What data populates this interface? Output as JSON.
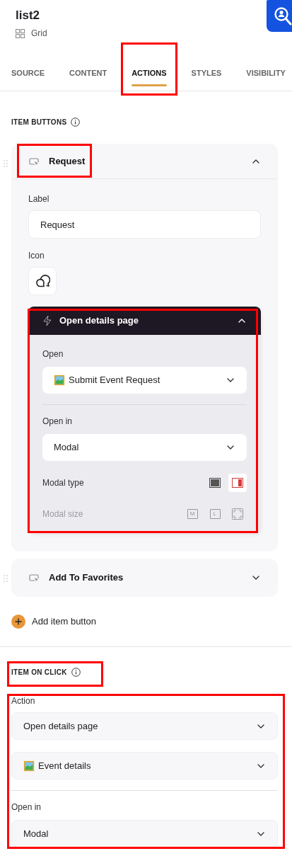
{
  "header": {
    "title": "list2",
    "subtitle": "Grid"
  },
  "tabs": [
    {
      "label": "SOURCE",
      "selected": false,
      "highlighted": false
    },
    {
      "label": "CONTENT",
      "selected": false,
      "highlighted": false
    },
    {
      "label": "ACTIONS",
      "selected": true,
      "highlighted": true
    },
    {
      "label": "STYLES",
      "selected": false,
      "highlighted": false
    },
    {
      "label": "VISIBILITY",
      "selected": false,
      "highlighted": false
    }
  ],
  "item_buttons": {
    "heading": "ITEM BUTTONS",
    "buttons": [
      {
        "label": "Request",
        "expanded": true,
        "highlighted": true,
        "label_field": {
          "label": "Label",
          "value": "Request"
        },
        "icon_field": {
          "label": "Icon"
        },
        "action": {
          "title": "Open details page",
          "expanded": true,
          "highlighted": true,
          "open": {
            "label": "Open",
            "value": "Submit Event Request"
          },
          "open_in": {
            "label": "Open in",
            "value": "Modal"
          },
          "modal_type": {
            "label": "Modal type",
            "options": [
              {
                "kind": "center",
                "selected": false
              },
              {
                "kind": "side",
                "selected": true
              }
            ]
          },
          "modal_size": {
            "label": "Modal size",
            "disabled": true,
            "options": [
              {
                "kind": "letter",
                "text": "M"
              },
              {
                "kind": "letter",
                "text": "L"
              },
              {
                "kind": "full"
              }
            ]
          }
        }
      },
      {
        "label": "Add To Favorites",
        "expanded": false,
        "highlighted": false
      }
    ],
    "add_button": "Add item button"
  },
  "item_on_click": {
    "heading": "ITEM ON CLICK",
    "highlighted": true,
    "fields_highlighted": true,
    "action": {
      "label": "Action",
      "value": "Open details page"
    },
    "page": {
      "value": "Event details"
    },
    "open_in": {
      "label": "Open in",
      "value": "Modal"
    }
  }
}
